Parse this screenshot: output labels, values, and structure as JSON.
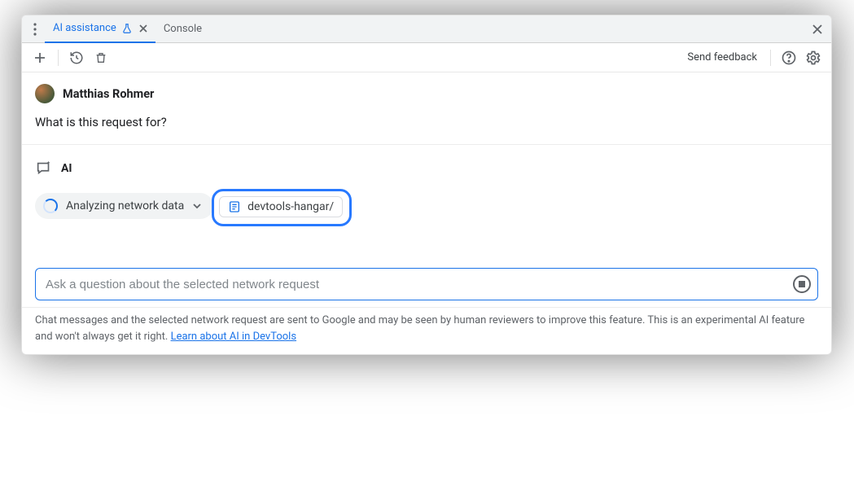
{
  "tabs": {
    "active": {
      "label": "AI assistance"
    },
    "other": {
      "label": "Console"
    }
  },
  "toolbar": {
    "send_feedback": "Send feedback"
  },
  "chat": {
    "username": "Matthias Rohmer",
    "user_message": "What is this request for?",
    "ai_label": "AI",
    "analyzing": "Analyzing network data",
    "context_chip": "devtools-hangar/"
  },
  "input": {
    "placeholder": "Ask a question about the selected network request"
  },
  "disclaimer": {
    "text_a": "Chat messages and the selected network request are sent to Google and may be seen by human reviewers to improve this feature. This is an experimental AI feature and won't always get it right. ",
    "link": "Learn about AI in DevTools"
  }
}
